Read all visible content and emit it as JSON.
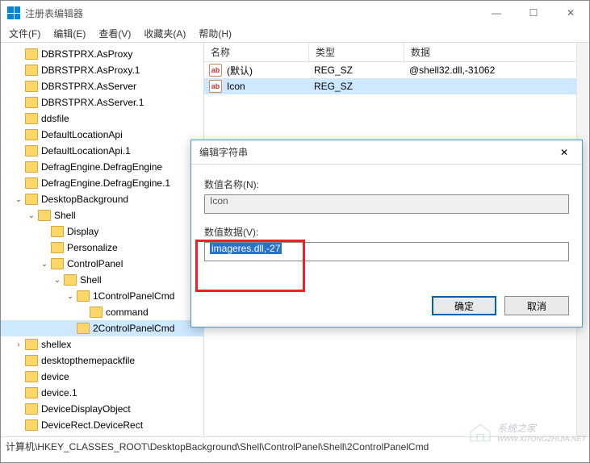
{
  "window": {
    "title": "注册表编辑器",
    "sys": {
      "min": "—",
      "max": "☐",
      "close": "✕"
    }
  },
  "menu": {
    "file": "文件(F)",
    "edit": "编辑(E)",
    "view": "查看(V)",
    "fav": "收藏夹(A)",
    "help": "帮助(H)"
  },
  "tree": [
    {
      "indent": 1,
      "arrow": "",
      "label": "DBRSTPRX.AsProxy"
    },
    {
      "indent": 1,
      "arrow": "",
      "label": "DBRSTPRX.AsProxy.1"
    },
    {
      "indent": 1,
      "arrow": "",
      "label": "DBRSTPRX.AsServer"
    },
    {
      "indent": 1,
      "arrow": "",
      "label": "DBRSTPRX.AsServer.1"
    },
    {
      "indent": 1,
      "arrow": "",
      "label": "ddsfile"
    },
    {
      "indent": 1,
      "arrow": "",
      "label": "DefaultLocationApi"
    },
    {
      "indent": 1,
      "arrow": "",
      "label": "DefaultLocationApi.1"
    },
    {
      "indent": 1,
      "arrow": "",
      "label": "DefragEngine.DefragEngine"
    },
    {
      "indent": 1,
      "arrow": "",
      "label": "DefragEngine.DefragEngine.1"
    },
    {
      "indent": 1,
      "arrow": "v",
      "label": "DesktopBackground"
    },
    {
      "indent": 2,
      "arrow": "v",
      "label": "Shell"
    },
    {
      "indent": 3,
      "arrow": "",
      "label": "Display"
    },
    {
      "indent": 3,
      "arrow": "",
      "label": "Personalize"
    },
    {
      "indent": 3,
      "arrow": "v",
      "label": "ControlPanel"
    },
    {
      "indent": 4,
      "arrow": "v",
      "label": "Shell"
    },
    {
      "indent": 5,
      "arrow": "v",
      "label": "1ControlPanelCmd"
    },
    {
      "indent": 6,
      "arrow": "",
      "label": "command"
    },
    {
      "indent": 5,
      "arrow": "",
      "label": "2ControlPanelCmd",
      "sel": true
    },
    {
      "indent": 1,
      "arrow": ">",
      "label": "shellex"
    },
    {
      "indent": 1,
      "arrow": "",
      "label": "desktopthemepackfile"
    },
    {
      "indent": 1,
      "arrow": "",
      "label": "device"
    },
    {
      "indent": 1,
      "arrow": "",
      "label": "device.1"
    },
    {
      "indent": 1,
      "arrow": "",
      "label": "DeviceDisplayObject"
    },
    {
      "indent": 1,
      "arrow": "",
      "label": "DeviceRect.DeviceRect"
    }
  ],
  "list": {
    "headers": {
      "name": "名称",
      "type": "类型",
      "data": "数据"
    },
    "rows": [
      {
        "name": "(默认)",
        "type": "REG_SZ",
        "data": "@shell32.dll,-31062"
      },
      {
        "name": "Icon",
        "type": "REG_SZ",
        "data": "",
        "sel": true
      }
    ]
  },
  "dialog": {
    "title": "编辑字符串",
    "nameLabel": "数值名称(N):",
    "nameValue": "Icon",
    "dataLabel": "数值数据(V):",
    "dataValue": "imageres.dll,-27",
    "ok": "确定",
    "cancel": "取消",
    "close": "✕"
  },
  "status": {
    "path": "计算机\\HKEY_CLASSES_ROOT\\DesktopBackground\\Shell\\ControlPanel\\Shell\\2ControlPanelCmd"
  },
  "watermark": {
    "line1": "系统之家",
    "line2": "WWW.XITONGZHIJIA.NET"
  }
}
